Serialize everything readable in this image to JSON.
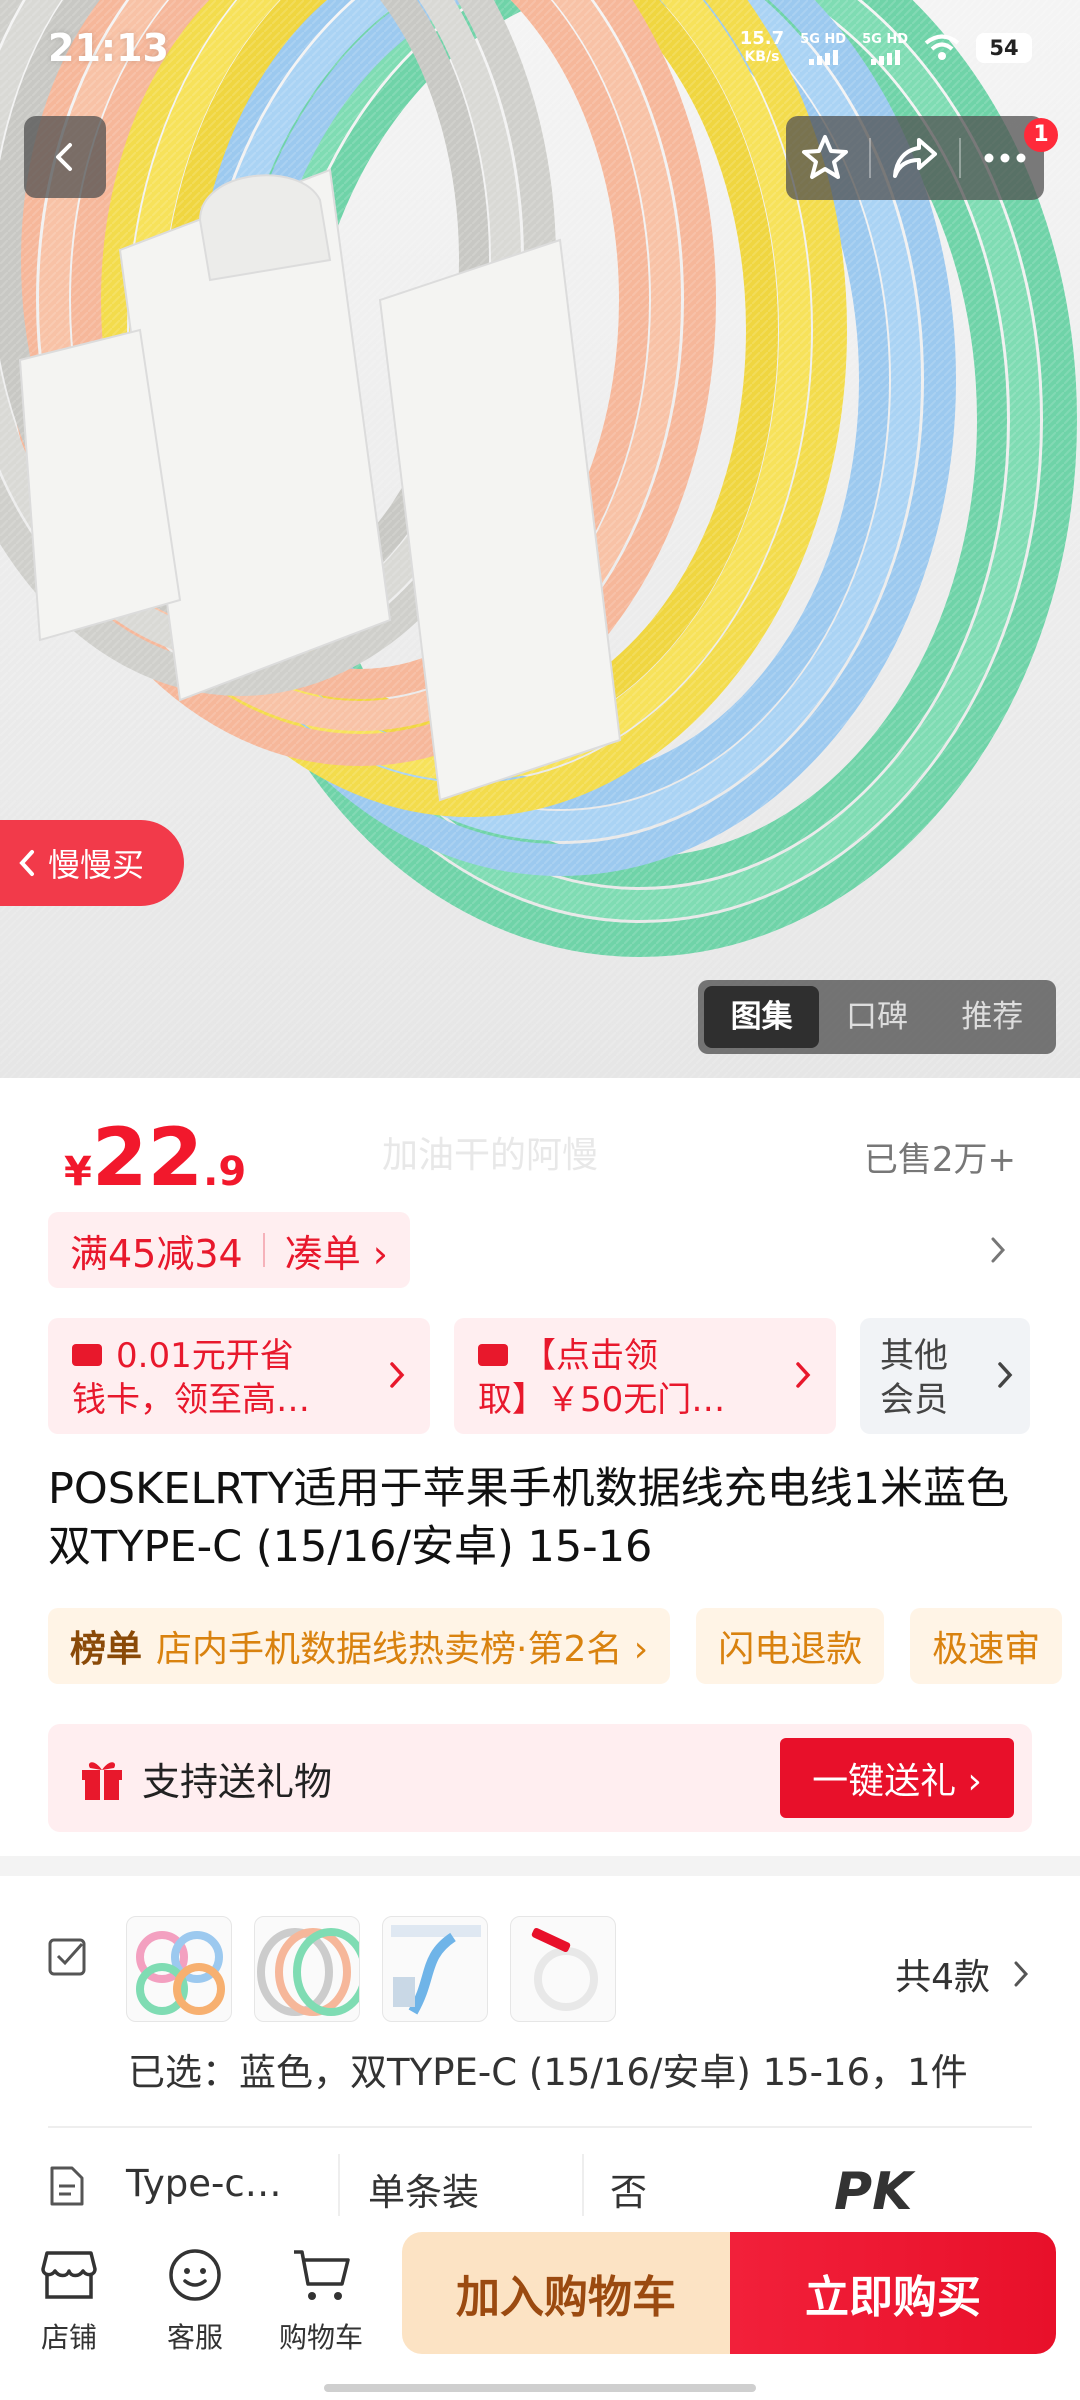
{
  "status_bar": {
    "time": "21:13",
    "net_speed": "15.7",
    "net_unit": "KB/s",
    "sim1": "5G HD",
    "sim2": "5G HD",
    "battery": "54"
  },
  "header": {
    "back_icon": "chevron-left-icon",
    "favorite_icon": "star-icon",
    "share_icon": "share-icon",
    "more_icon": "more-dots-icon",
    "notification_count": "1"
  },
  "hero": {
    "slow_buy_label": "慢慢买",
    "gallery_tabs": [
      {
        "label": "图集",
        "active": true
      },
      {
        "label": "口碑",
        "active": false
      },
      {
        "label": "推荐",
        "active": false
      }
    ]
  },
  "price": {
    "currency": "¥",
    "integer": "22",
    "decimal": ".9",
    "watermark": "加油干的阿慢",
    "sold": "已售2万+"
  },
  "promo": {
    "discount": "满45减34",
    "combine": "凑单 ›"
  },
  "coupons": [
    {
      "line1": "0.01元开省",
      "line2": "钱卡，领至高…"
    },
    {
      "line1": "【点击领",
      "line2": "取】￥50无门…"
    },
    {
      "line1": "其他",
      "line2": "会员"
    }
  ],
  "product": {
    "title": "POSKELRTY适用于苹果手机数据线充电线1米蓝色 双TYPE-C (15/16/安卓) 15-16"
  },
  "tags": {
    "rank_label": "榜单",
    "rank_text": "店内手机数据线热卖榜·第2名 ›",
    "refund": "闪电退款",
    "fast": "极速审"
  },
  "gift": {
    "label": "支持送礼物",
    "button": "一键送礼 ›"
  },
  "variants": {
    "count": "共4款",
    "selected": "已选：蓝色，双TYPE-C (15/16/安卓) 15-16，1件",
    "specs": [
      "Type-c…",
      "单条装",
      "否"
    ],
    "pk": "PK"
  },
  "bottom_nav": [
    {
      "label": "店铺",
      "icon": "store-icon"
    },
    {
      "label": "客服",
      "icon": "customer-service-icon"
    },
    {
      "label": "购物车",
      "icon": "cart-icon"
    }
  ],
  "actions": {
    "add_to_cart": "加入购物车",
    "buy_now": "立即购买"
  },
  "colors": {
    "price_red": "#f2182c",
    "buy_red": "#e8102a",
    "cart_bg": "#fce3c4",
    "cart_text": "#9b4a10"
  }
}
